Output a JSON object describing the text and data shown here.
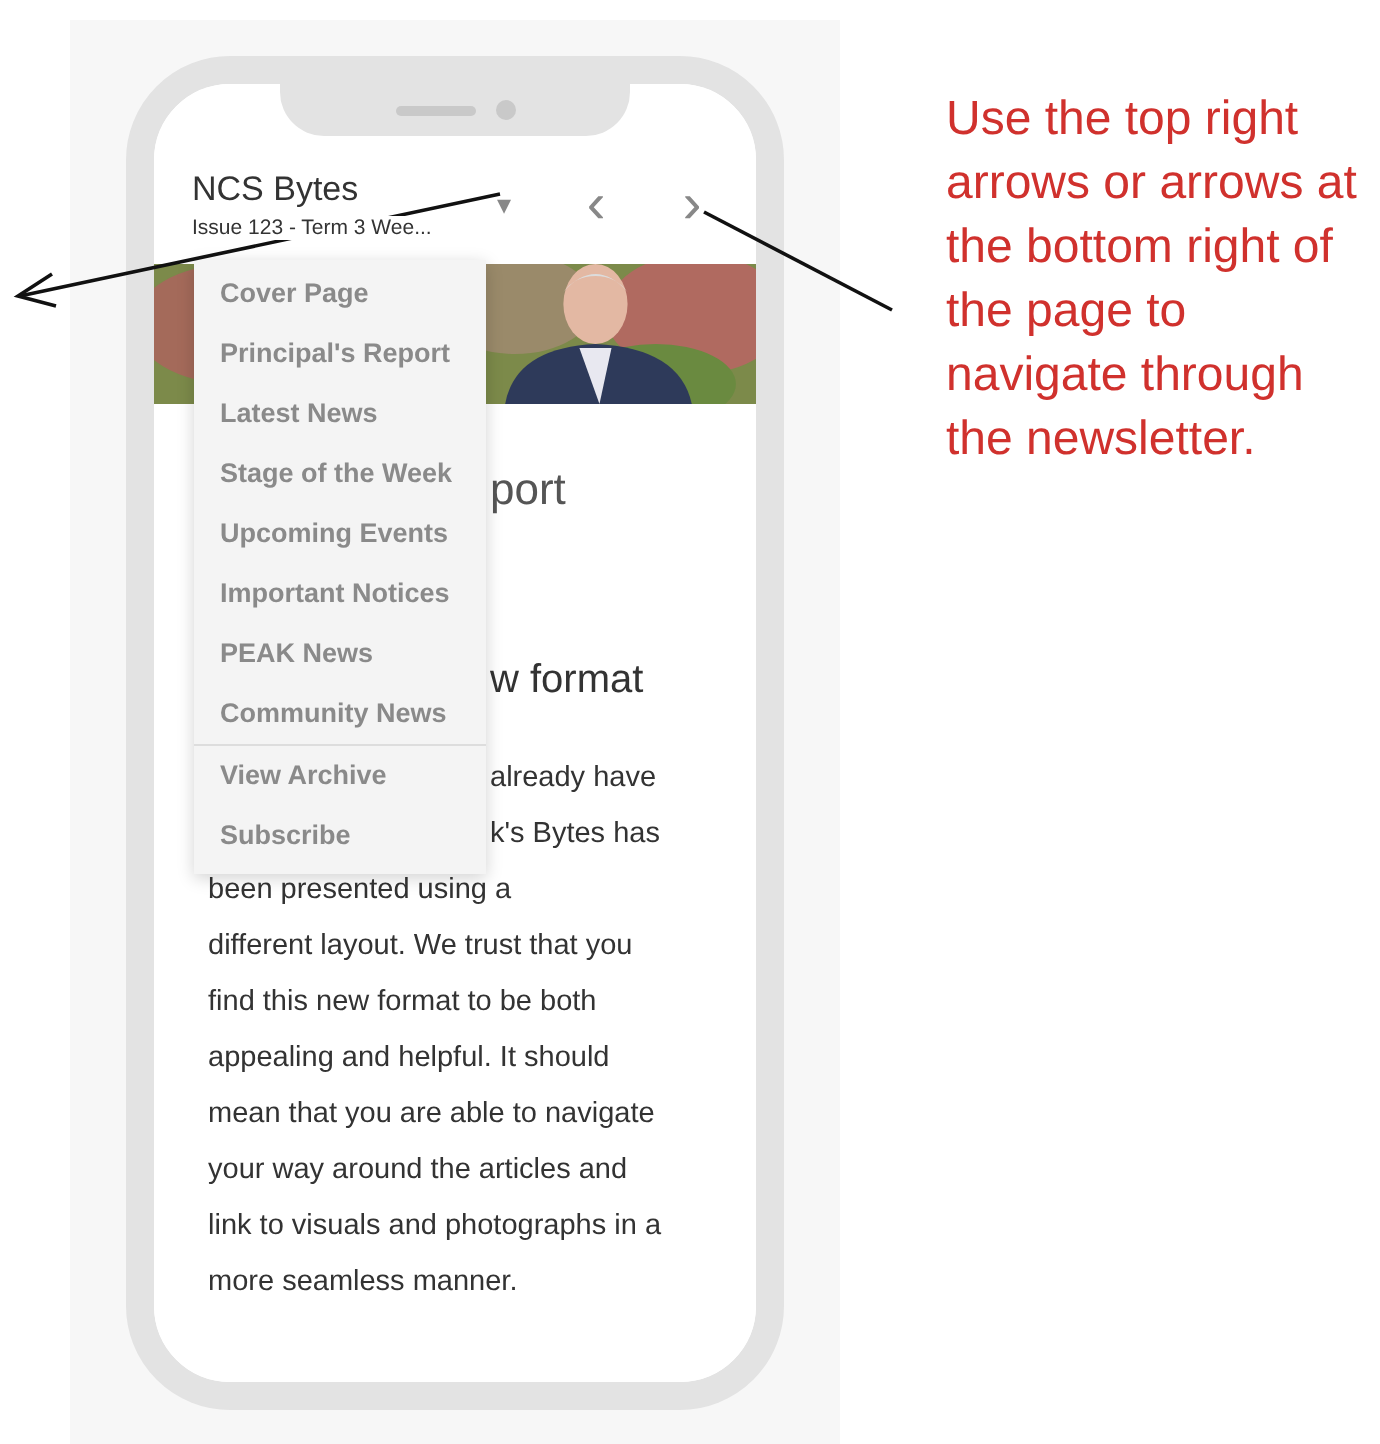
{
  "phone": {
    "header": {
      "title": "NCS Bytes",
      "subtitle": "Issue 123 - Term 3 Wee...",
      "menu_caret": "▾",
      "prev": "‹",
      "next": "›"
    },
    "menu": {
      "items": [
        {
          "label": "Cover Page",
          "kind": "section"
        },
        {
          "label": "Principal's Report",
          "kind": "section"
        },
        {
          "label": "Latest News",
          "kind": "section"
        },
        {
          "label": "Stage of the Week",
          "kind": "section"
        },
        {
          "label": "Upcoming Events",
          "kind": "section"
        },
        {
          "label": "Important Notices",
          "kind": "section"
        },
        {
          "label": "PEAK News",
          "kind": "section"
        },
        {
          "label": "Community News",
          "kind": "section"
        },
        {
          "label": "View Archive",
          "kind": "extra"
        },
        {
          "label": "Subscribe",
          "kind": "extra"
        }
      ]
    },
    "article": {
      "heading": "port",
      "subheading": "w format",
      "lines": [
        {
          "text": "already have",
          "kind": "covered"
        },
        {
          "text": "k's Bytes has",
          "kind": "covered"
        },
        {
          "text": "been presented using a",
          "kind": "full"
        },
        {
          "text": "different layout. We trust that you",
          "kind": "full"
        },
        {
          "text": "find this new format to be both",
          "kind": "full"
        },
        {
          "text": "appealing and helpful. It should",
          "kind": "full"
        },
        {
          "text": "mean that you are able to navigate",
          "kind": "full"
        },
        {
          "text": "your way around the articles and",
          "kind": "full"
        },
        {
          "text": "link to visuals and photographs in a",
          "kind": "full"
        },
        {
          "text": "more seamless manner.",
          "kind": "full"
        }
      ]
    }
  },
  "annotation": {
    "text": "Use the top right arrows or arrows at the bottom right of the page to navigate through the newsletter."
  }
}
